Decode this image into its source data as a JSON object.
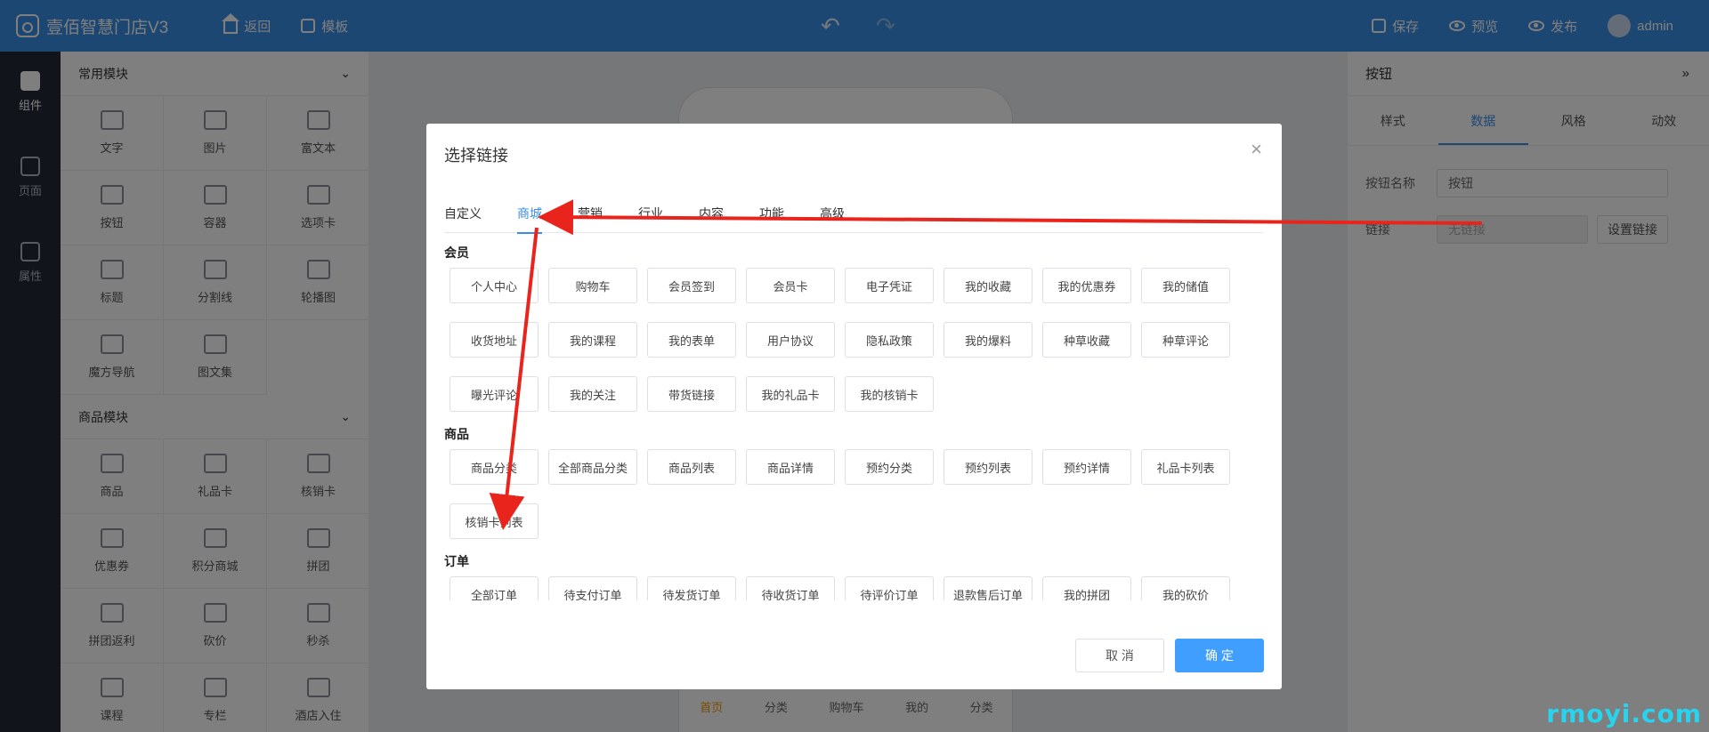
{
  "header": {
    "title": "壹佰智慧门店V3",
    "back_label": "返回",
    "template_label": "模板",
    "save_label": "保存",
    "preview_label": "预览",
    "publish_label": "发布",
    "user": "admin"
  },
  "rail": [
    {
      "label": "组件",
      "active": true
    },
    {
      "label": "页面"
    },
    {
      "label": "属性"
    }
  ],
  "panel": {
    "common_title": "常用模块",
    "common_items": [
      "文字",
      "图片",
      "富文本",
      "按钮",
      "容器",
      "选项卡",
      "标题",
      "分割线",
      "轮播图",
      "魔方导航",
      "图文集"
    ],
    "goods_title": "商品模块",
    "goods_items": [
      "商品",
      "礼品卡",
      "核销卡",
      "优惠券",
      "积分商城",
      "拼团",
      "拼团返利",
      "砍价",
      "秒杀",
      "课程",
      "专栏",
      "酒店入住"
    ]
  },
  "phone": {
    "tabbar": [
      "首页",
      "分类",
      "购物车",
      "我的",
      "分类"
    ]
  },
  "right_panel": {
    "title": "按钮",
    "tabs": [
      "样式",
      "数据",
      "风格",
      "动效"
    ],
    "name_label": "按钮名称",
    "name_value": "按钮",
    "link_label": "链接",
    "link_value": "无链接",
    "set_link_button": "设置链接"
  },
  "modal": {
    "title": "选择链接",
    "tabs": [
      "自定义",
      "商城",
      "营销",
      "行业",
      "内容",
      "功能",
      "高级"
    ],
    "active_tab": 1,
    "groups": [
      {
        "name": "会员",
        "items": [
          "个人中心",
          "购物车",
          "会员签到",
          "会员卡",
          "电子凭证",
          "我的收藏",
          "我的优惠券",
          "我的储值",
          "收货地址",
          "我的课程",
          "我的表单",
          "用户协议",
          "隐私政策",
          "我的爆料",
          "种草收藏",
          "种草评论",
          "曝光评论",
          "我的关注",
          "带货链接",
          "我的礼品卡",
          "我的核销卡"
        ]
      },
      {
        "name": "商品",
        "items": [
          "商品分类",
          "全部商品分类",
          "商品列表",
          "商品详情",
          "预约分类",
          "预约列表",
          "预约详情",
          "礼品卡列表",
          "核销卡列表"
        ]
      },
      {
        "name": "订单",
        "items": [
          "全部订单",
          "待支付订单",
          "待发货订单",
          "待收货订单",
          "待评价订单",
          "退款售后订单",
          "我的拼团",
          "我的砍价"
        ]
      }
    ],
    "cancel_label": "取 消",
    "confirm_label": "确 定"
  },
  "annotation": {
    "color": "#e8241c"
  },
  "watermark": "rmoyi.com"
}
